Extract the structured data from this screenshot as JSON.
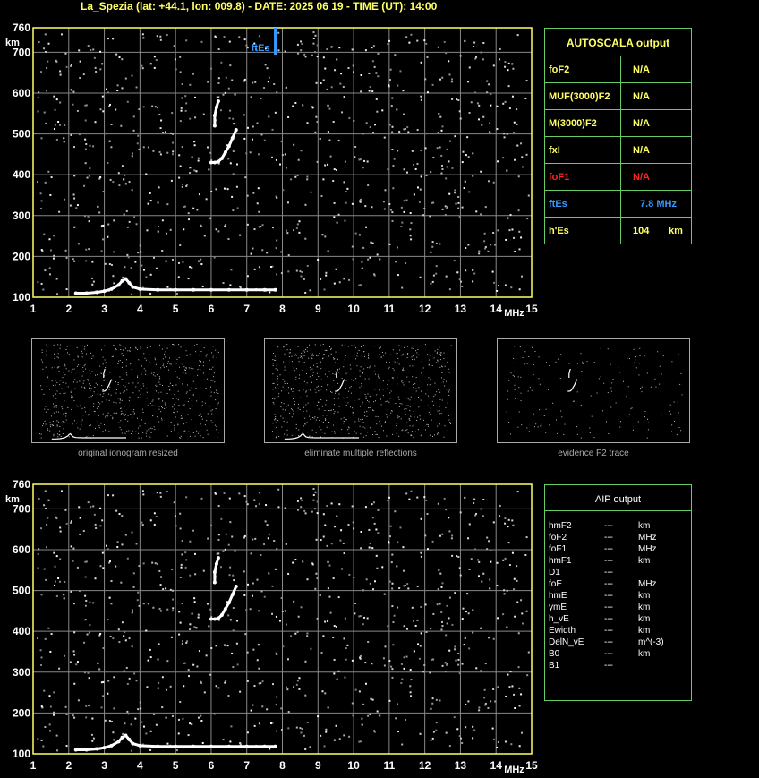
{
  "title": "La_Spezia (lat: +44.1, lon: 009.8) - DATE: 2025 06 19 - TIME (UT): 14:00",
  "colors": {
    "axis": "#ffff66",
    "grid": "#888888",
    "trace": "#ffffff",
    "panel_border": "#66cc66",
    "es_marker": "#3399ff",
    "fof1": "#ff2222"
  },
  "chart_data": [
    {
      "type": "scatter",
      "title": "",
      "xlabel": "MHz",
      "ylabel": "km",
      "xlim": [
        1,
        15
      ],
      "ylim": [
        100,
        760
      ],
      "x_ticks": [
        "1",
        "2",
        "3",
        "4",
        "5",
        "6",
        "7",
        "8",
        "9",
        "10",
        "11",
        "12",
        "13",
        "14",
        "15"
      ],
      "y_ticks": [
        "100",
        "200",
        "300",
        "400",
        "500",
        "600",
        "700",
        "760"
      ],
      "annotation": {
        "label": "ftEs",
        "x": 7.8
      },
      "series": [
        {
          "x": [
            2.2,
            2.5,
            2.8,
            3.0,
            3.2,
            3.4,
            3.5,
            3.6,
            3.7,
            3.8,
            4.0,
            4.5,
            5.0,
            5.5,
            6.0,
            6.5,
            7.0,
            7.5,
            7.8
          ],
          "y": [
            110,
            110,
            112,
            115,
            120,
            130,
            140,
            145,
            135,
            125,
            120,
            118,
            118,
            118,
            118,
            118,
            118,
            118,
            118
          ]
        },
        {
          "x": [
            6.0,
            6.1,
            6.2,
            6.3,
            6.4,
            6.5,
            6.6,
            6.7
          ],
          "y": [
            430,
            430,
            432,
            440,
            455,
            470,
            490,
            510
          ]
        },
        {
          "x": [
            6.1,
            6.1,
            6.15,
            6.2
          ],
          "y": [
            520,
            545,
            565,
            580
          ]
        }
      ]
    },
    {
      "type": "scatter",
      "title": "",
      "xlabel": "MHz",
      "ylabel": "km",
      "xlim": [
        1,
        15
      ],
      "ylim": [
        100,
        760
      ],
      "x_ticks": [
        "1",
        "2",
        "3",
        "4",
        "5",
        "6",
        "7",
        "8",
        "9",
        "10",
        "11",
        "12",
        "13",
        "14",
        "15"
      ],
      "y_ticks": [
        "100",
        "200",
        "300",
        "400",
        "500",
        "600",
        "700",
        "760"
      ],
      "series": [
        {
          "x": [
            2.2,
            2.5,
            2.8,
            3.0,
            3.2,
            3.4,
            3.5,
            3.6,
            3.7,
            3.8,
            4.0,
            4.5,
            5.0,
            5.5,
            6.0,
            6.5,
            7.0,
            7.5,
            7.8
          ],
          "y": [
            110,
            110,
            112,
            115,
            120,
            130,
            140,
            145,
            135,
            125,
            120,
            118,
            118,
            118,
            118,
            118,
            118,
            118,
            118
          ]
        },
        {
          "x": [
            6.0,
            6.1,
            6.2,
            6.3,
            6.4,
            6.5,
            6.6,
            6.7
          ],
          "y": [
            430,
            430,
            432,
            440,
            455,
            470,
            490,
            510
          ]
        },
        {
          "x": [
            6.1,
            6.1,
            6.15,
            6.2
          ],
          "y": [
            520,
            545,
            565,
            580
          ]
        }
      ]
    }
  ],
  "autoscala": {
    "title": "AUTOSCALA output",
    "rows": [
      {
        "key": "foF2",
        "value": "N/A",
        "unit": "",
        "color": "#ffff66"
      },
      {
        "key": "MUF(3000)F2",
        "value": "N/A",
        "unit": "",
        "color": "#ffff66"
      },
      {
        "key": "M(3000)F2",
        "value": "N/A",
        "unit": "",
        "color": "#ffff66"
      },
      {
        "key": "fxI",
        "value": "N/A",
        "unit": "",
        "color": "#ffff66"
      },
      {
        "key": "foF1",
        "value": "N/A",
        "unit": "",
        "color": "#ff2222"
      },
      {
        "key": "ftEs",
        "value": "7.8 MHz",
        "unit": "",
        "color": "#3399ff"
      },
      {
        "key": "h'Es",
        "value": "104",
        "unit": "km",
        "color": "#ffff66"
      }
    ]
  },
  "aip": {
    "title": "AIP output",
    "rows": [
      {
        "key": "hmF2",
        "value": "---",
        "unit": "km"
      },
      {
        "key": "foF2",
        "value": "---",
        "unit": "MHz"
      },
      {
        "key": "foF1",
        "value": "---",
        "unit": "MHz"
      },
      {
        "key": "hmF1",
        "value": "---",
        "unit": "km"
      },
      {
        "key": "D1",
        "value": "---",
        "unit": ""
      },
      {
        "key": "foE",
        "value": "---",
        "unit": "MHz"
      },
      {
        "key": "hmE",
        "value": "---",
        "unit": "km"
      },
      {
        "key": "ymE",
        "value": "---",
        "unit": "km"
      },
      {
        "key": "h_vE",
        "value": "---",
        "unit": "km"
      },
      {
        "key": "Ewidth",
        "value": "---",
        "unit": "km"
      },
      {
        "key": "DelN_vE",
        "value": "---",
        "unit": "m^(-3)"
      },
      {
        "key": "B0",
        "value": "---",
        "unit": "km"
      },
      {
        "key": "B1",
        "value": "---",
        "unit": ""
      }
    ]
  },
  "thumbnails": [
    {
      "caption": "original ionogram resized"
    },
    {
      "caption": "eliminate multiple reflections"
    },
    {
      "caption": "evidence F2 trace"
    }
  ]
}
